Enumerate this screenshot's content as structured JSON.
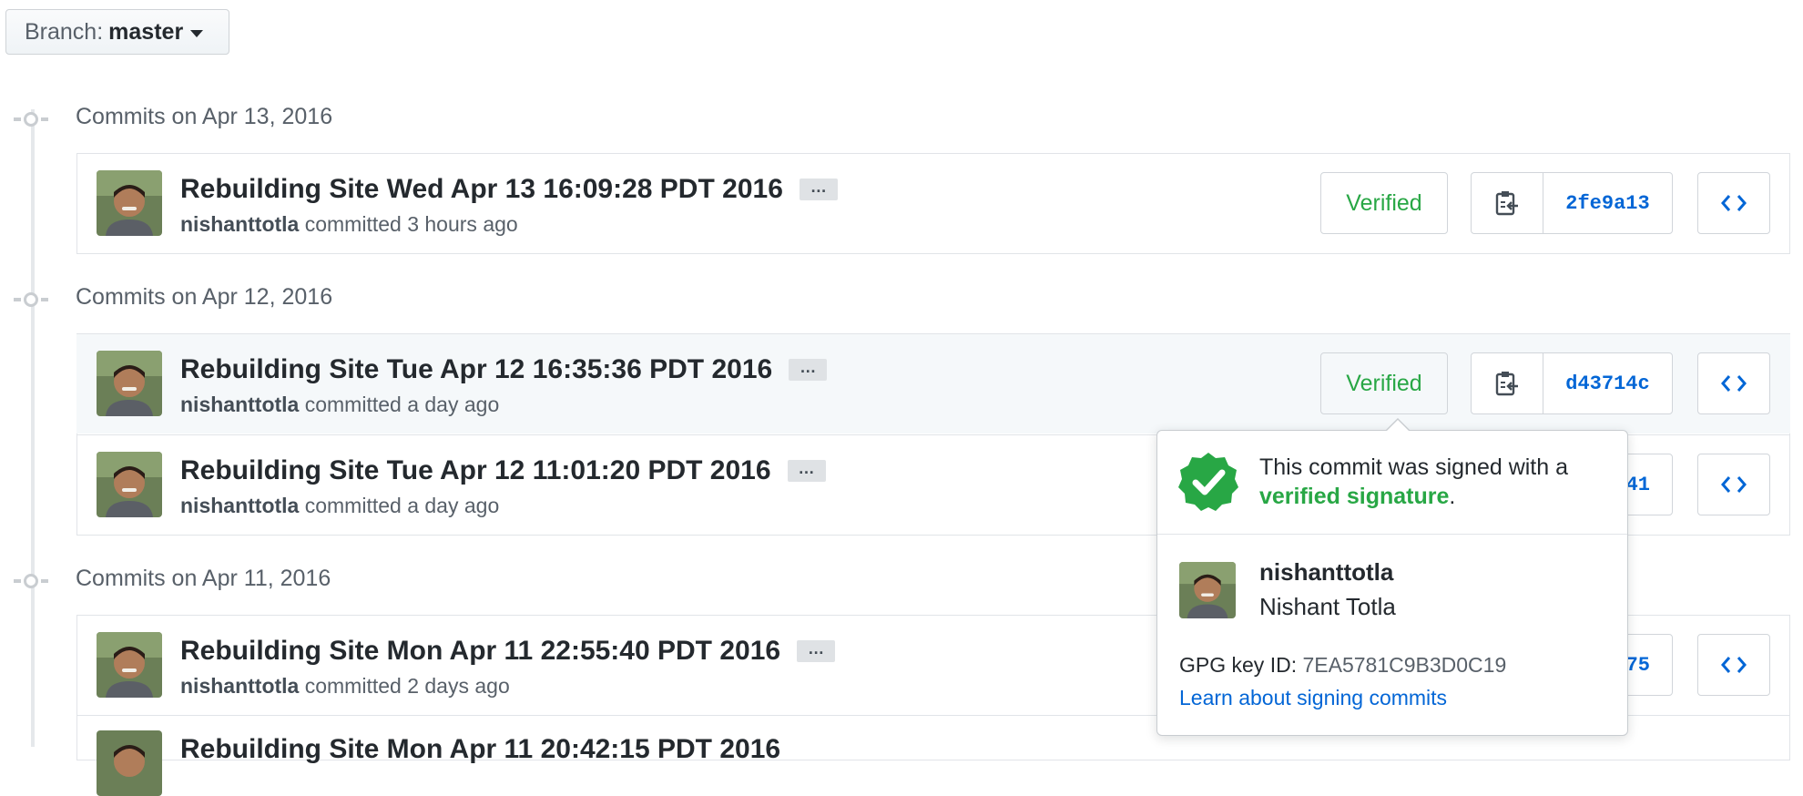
{
  "branch": {
    "label": "Branch:",
    "value": "master"
  },
  "groups": [
    {
      "title": "Commits on Apr 13, 2016"
    },
    {
      "title": "Commits on Apr 12, 2016"
    },
    {
      "title": "Commits on Apr 11, 2016"
    }
  ],
  "commits": [
    {
      "title": "Rebuilding Site Wed Apr 13 16:09:28 PDT 2016",
      "ellipsis": "…",
      "author": "nishanttotla",
      "committed": "committed 3 hours ago",
      "verified": "Verified",
      "sha": "2fe9a13"
    },
    {
      "title": "Rebuilding Site Tue Apr 12 16:35:36 PDT 2016",
      "ellipsis": "…",
      "author": "nishanttotla",
      "committed": "committed a day ago",
      "verified": "Verified",
      "sha": "d43714c"
    },
    {
      "title": "Rebuilding Site Tue Apr 12 11:01:20 PDT 2016",
      "ellipsis": "…",
      "author": "nishanttotla",
      "committed": "committed a day ago",
      "sha": "41"
    },
    {
      "title": "Rebuilding Site Mon Apr 11 22:55:40 PDT 2016",
      "ellipsis": "…",
      "author": "nishanttotla",
      "committed": "committed 2 days ago",
      "sha": "75"
    }
  ],
  "popover": {
    "message": "This commit was signed with a",
    "verified_text": "verified signature",
    "period": ".",
    "username": "nishanttotla",
    "fullname": "Nishant Totla",
    "gpg_label": "GPG key ID:",
    "gpg_value": "7EA5781C9B3D0C19",
    "learn_link": "Learn about signing commits"
  },
  "partial": {
    "title": "Rebuilding Site Mon Apr 11 20:42:15 PDT 2016"
  },
  "colors": {
    "verified": "#28a745",
    "link": "#0366d6",
    "muted": "#586069"
  },
  "icons": [
    "caret-down-icon",
    "clipboard-icon",
    "code-icon",
    "verified-badge-icon"
  ]
}
